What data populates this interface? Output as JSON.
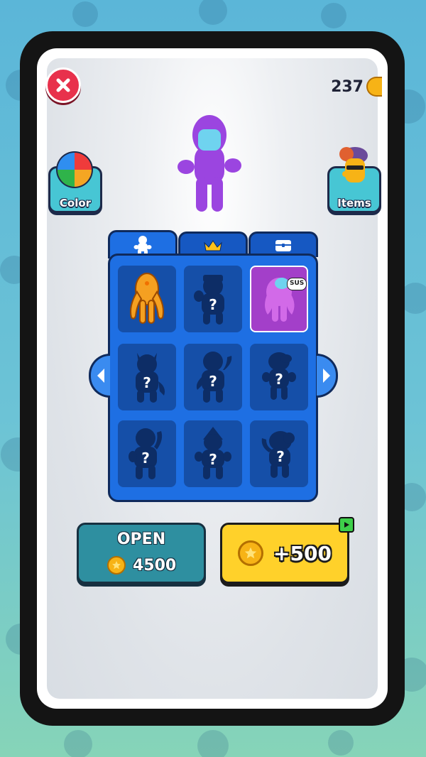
{
  "header": {
    "coin_count": "237",
    "close_icon": "close-icon"
  },
  "side_buttons": {
    "color_label": "Color",
    "items_label": "Items"
  },
  "tabs": [
    {
      "name": "characters",
      "icon": "character-icon",
      "active": true
    },
    {
      "name": "crown",
      "icon": "crown-icon",
      "active": false
    },
    {
      "name": "chest",
      "icon": "chest-icon",
      "active": false
    }
  ],
  "grid": {
    "cells": [
      {
        "state": "unlocked",
        "color": "#f5a021"
      },
      {
        "state": "locked",
        "label": "?"
      },
      {
        "state": "selected",
        "color": "#c24bd8",
        "bubble": "SUS"
      },
      {
        "state": "locked",
        "label": "?"
      },
      {
        "state": "locked",
        "label": "?"
      },
      {
        "state": "locked",
        "label": "?"
      },
      {
        "state": "locked",
        "label": "?"
      },
      {
        "state": "locked",
        "label": "?"
      },
      {
        "state": "locked",
        "label": "?"
      }
    ]
  },
  "open_button": {
    "title": "OPEN",
    "price": "4500"
  },
  "reward_button": {
    "amount": "+500",
    "badge_icon": "play-icon"
  },
  "colors": {
    "panel": "#1e6fe3",
    "close": "#e8314c",
    "open_button": "#2e8fa0",
    "reward_button": "#ffd12a",
    "coin": "#f7b316",
    "preview_character": "#9b45e0"
  }
}
